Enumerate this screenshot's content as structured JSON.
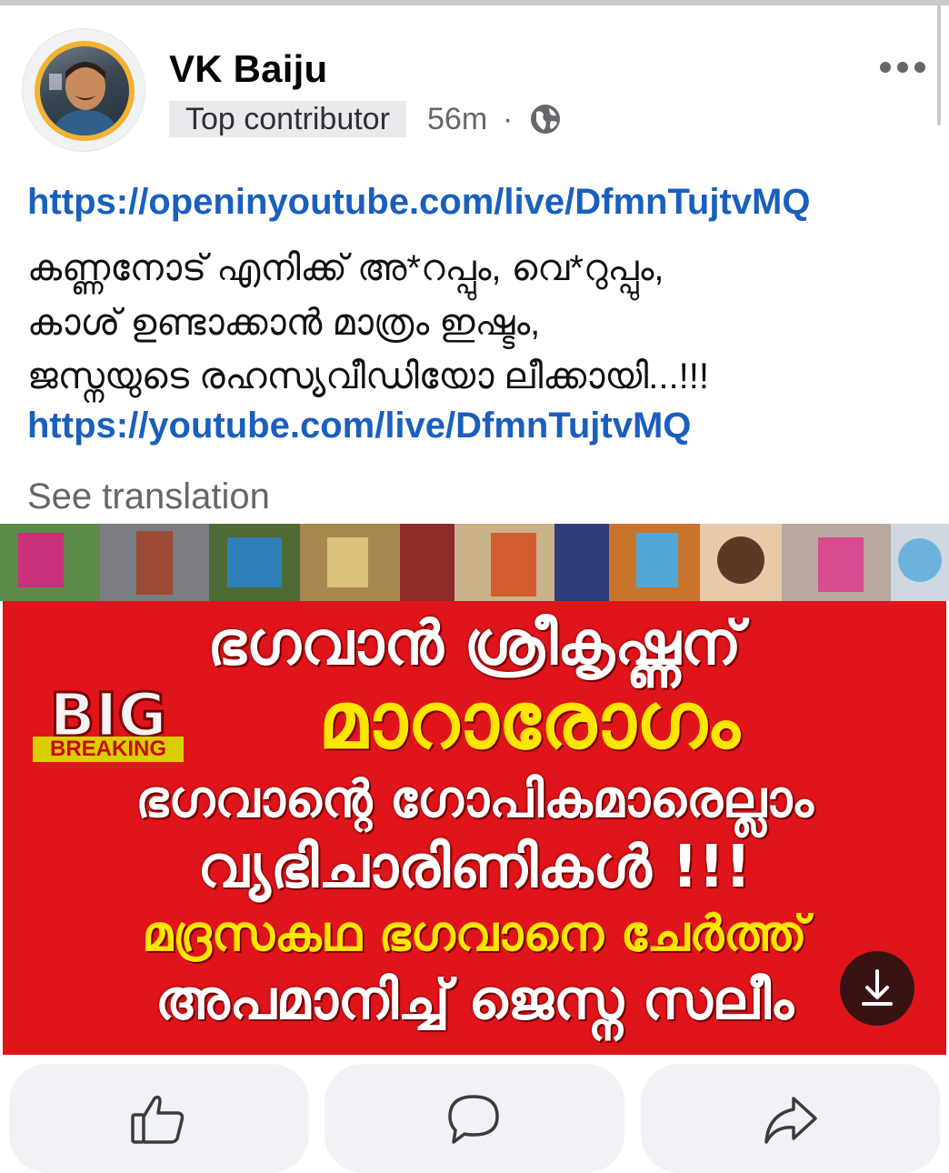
{
  "post": {
    "author": "VK Baiju",
    "badge": "Top contributor",
    "time": "56m",
    "separator": "·",
    "privacy_icon": "globe-icon",
    "more_icon": "more-options-icon",
    "link1": "https://openinyoutube.com/live/DfmnTujtvMQ",
    "line1": "കണ്ണനോട് എനിക്ക് അ*റപ്പും, വെ*റുപ്പും,",
    "line2": "കാശ് ഉണ്ടാക്കാൻ മാത്രം ഇഷ്ടം,",
    "line3": "ജസ്നയുടെ രഹസ്യവീഡിയോ ലീക്കായി...!!!",
    "link2": "https://youtube.com/live/DfmnTujtvMQ",
    "see_translation": "See translation"
  },
  "image": {
    "line1": "ഭഗവാൻ ശ്രീകൃഷ്ണന്",
    "line2": "മാറാരോഗം",
    "line3": "ഭഗവാന്റെ ഗോപികമാരെല്ലാം",
    "line4": "വ്യഭിചാരിണികൾ !!!",
    "line5": "മദ്രസകഥ  ഭഗവാനെ ചേർത്ത്",
    "line6": "അപമാനിച്ച് ജെസ്ന സലീം",
    "big_logo": "BIG",
    "breaking_label": "BREAKING",
    "download_icon": "download-icon"
  },
  "actions": {
    "like_icon": "like-icon",
    "comment_icon": "comment-icon",
    "share_icon": "share-icon"
  },
  "colors": {
    "link": "#1a5fbd",
    "banner_red": "#e0151b",
    "banner_yellow": "#ffe600",
    "avatar_ring": "#f2b233"
  }
}
